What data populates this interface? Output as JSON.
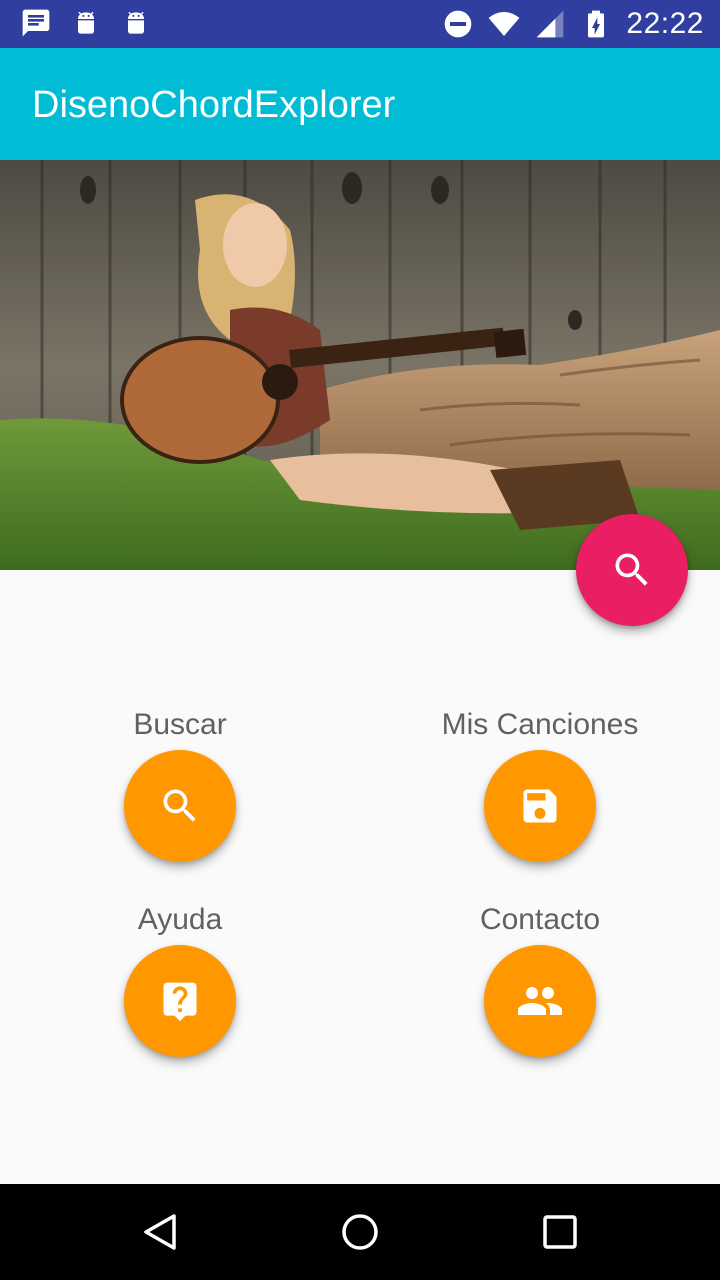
{
  "status_bar": {
    "time": "22:22",
    "left_icons": [
      "message-icon",
      "android-icon",
      "android-icon"
    ],
    "right_icons": [
      "do-not-disturb-icon",
      "wifi-icon",
      "signal-icon",
      "battery-charging-icon"
    ],
    "background": "#303f9f"
  },
  "app_bar": {
    "title": "DisenoChordExplorer",
    "background": "#00bcd4"
  },
  "hero": {
    "image_subject": "woman playing acoustic guitar sitting on grass against wooden fence"
  },
  "main_fab": {
    "icon": "search-icon",
    "color": "#e91e63"
  },
  "actions": [
    {
      "label": "Buscar",
      "icon": "search-icon"
    },
    {
      "label": "Mis Canciones",
      "icon": "save-icon"
    },
    {
      "label": "Ayuda",
      "icon": "help-icon"
    },
    {
      "label": "Contacto",
      "icon": "people-icon"
    }
  ],
  "accent_color": "#ff9800",
  "nav_bar": {
    "buttons": [
      "back-icon",
      "home-icon",
      "recents-icon"
    ]
  }
}
